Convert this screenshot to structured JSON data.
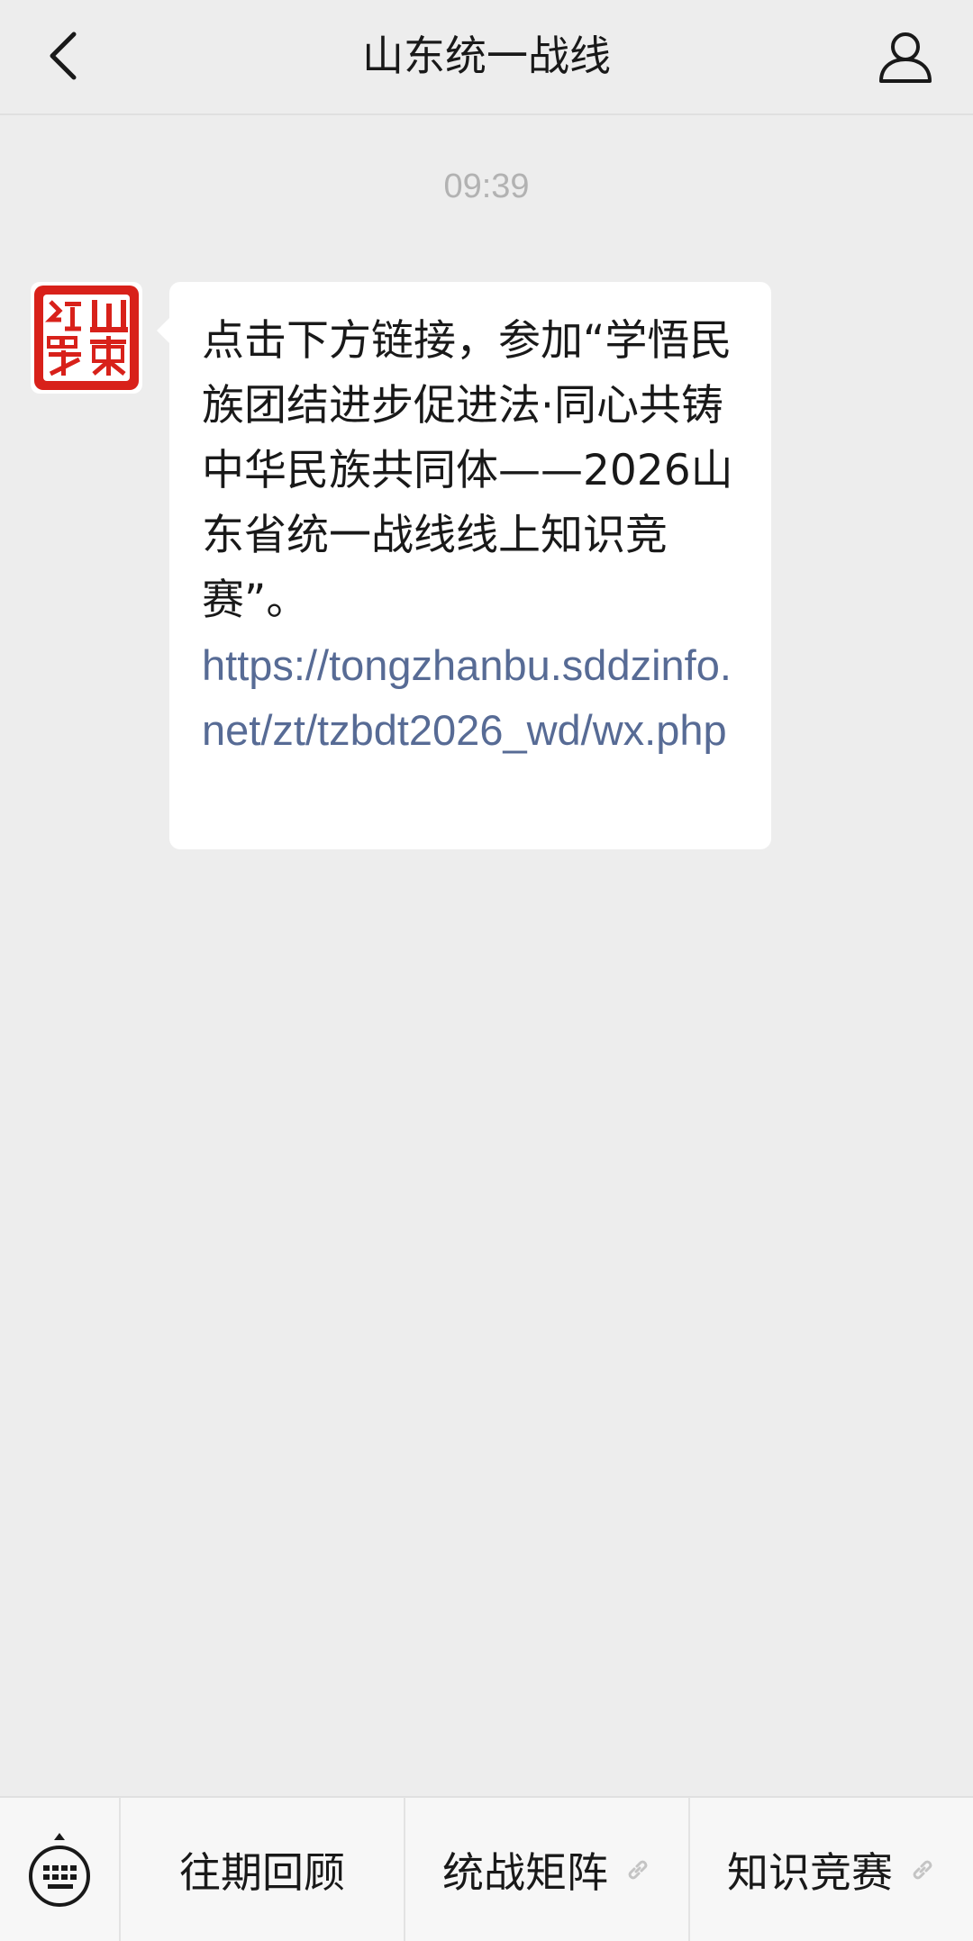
{
  "header": {
    "title": "山东统一战线",
    "back_icon": "chevron-left-icon",
    "profile_icon": "person-icon"
  },
  "chat": {
    "timestamp": "09:39",
    "avatar": {
      "logo_text": "山東統戰",
      "color": "#d8211a"
    },
    "message": {
      "text": "点击下方链接，参加“学悟民族团结进步促进法·同心共铸中华民族共同体——2026山东省统一战线线上知识竞赛”。",
      "link": "https://tongzhanbu.sddzinfo.net/zt/tzbdt2026_wd/wx.php"
    }
  },
  "bottom_bar": {
    "keyboard_icon": "keyboard-icon",
    "menu": [
      {
        "label": "往期回顾",
        "has_link_icon": false
      },
      {
        "label": "统战矩阵",
        "has_link_icon": true
      },
      {
        "label": "知识竞赛",
        "has_link_icon": true
      }
    ]
  },
  "colors": {
    "background": "#ededed",
    "bubble": "#ffffff",
    "link": "#576b95",
    "timestamp": "#b2b2b2",
    "logo_red": "#d8211a"
  }
}
